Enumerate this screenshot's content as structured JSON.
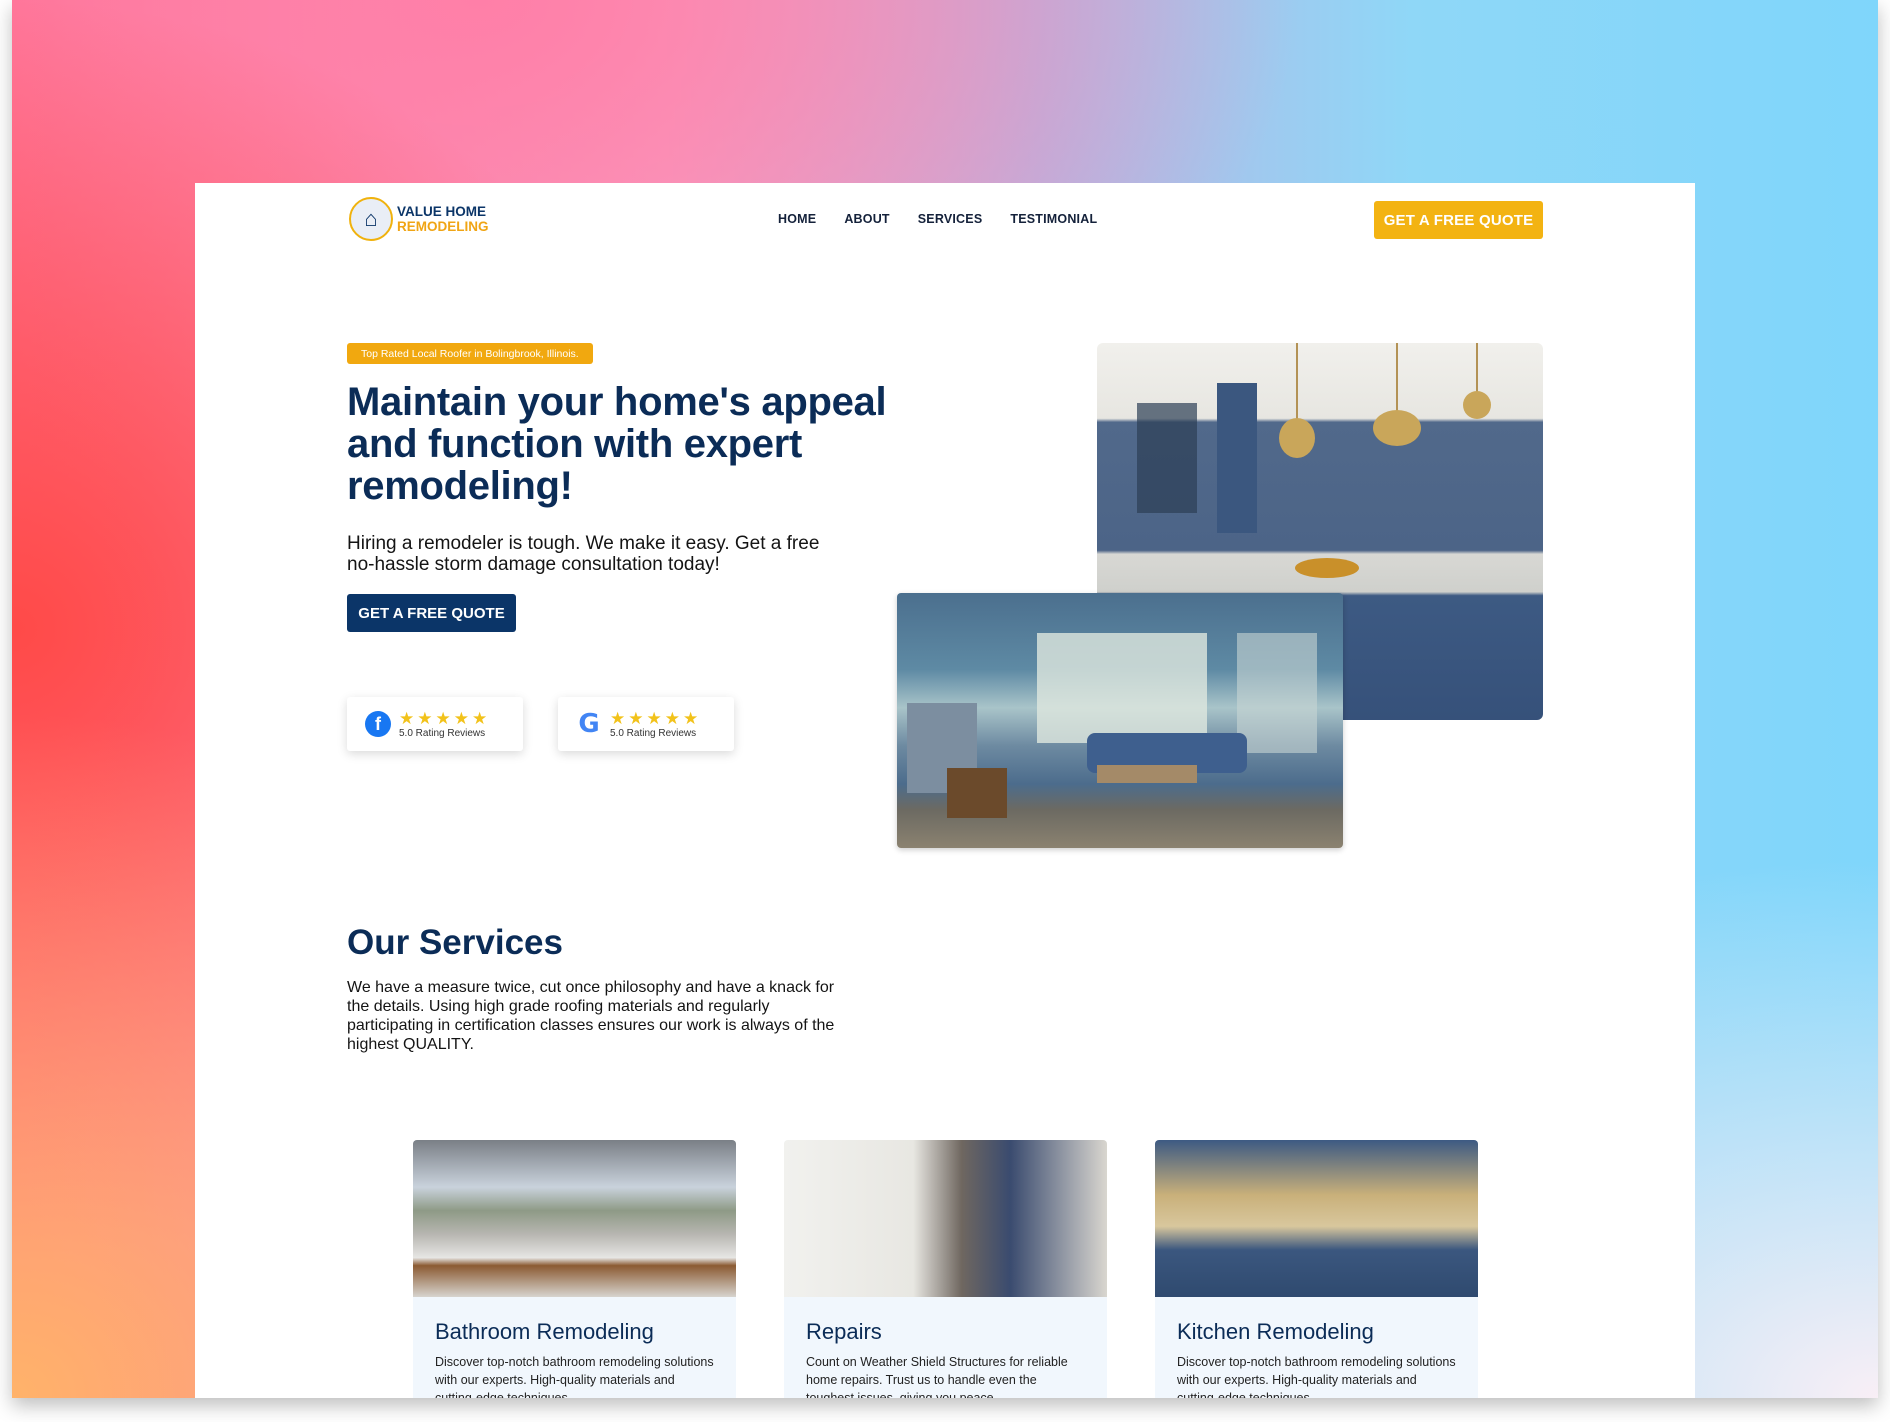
{
  "header": {
    "logo_line1": "VALUE HOME",
    "logo_line2": "REMODELING",
    "nav": [
      "HOME",
      "ABOUT",
      "SERVICES",
      "TESTIMONIAL"
    ],
    "cta": "GET A FREE QUOTE"
  },
  "hero": {
    "tag": "Top Rated Local Roofer in Bolingbrook, Illinois.",
    "title": "Maintain your home's appeal and function with expert remodeling!",
    "subtitle": "Hiring a remodeler is tough. We make it easy. Get a free no-hassle storm damage consultation today!",
    "cta": "GET A FREE QUOTE",
    "reviews": [
      {
        "icon": "facebook-icon",
        "stars": "★★★★★",
        "text": "5.0 Rating Reviews"
      },
      {
        "icon": "google-icon",
        "stars": "★★★★★",
        "text": "5.0 Rating Reviews"
      }
    ]
  },
  "services": {
    "title": "Our Services",
    "description": "We have a measure twice, cut once philosophy and have a knack for the details. Using high grade roofing materials and regularly participating in certification classes ensures our work is always of the highest QUALITY.",
    "cards": [
      {
        "title": "Bathroom Remodeling",
        "text": "Discover top-notch bathroom remodeling solutions with our experts. High-quality materials and cutting-edge techniques"
      },
      {
        "title": "Repairs",
        "text": "Count on Weather Shield Structures for reliable home repairs. Trust us to handle even the toughest issues, giving you peace"
      },
      {
        "title": "Kitchen Remodeling",
        "text": "Discover top-notch bathroom remodeling solutions with our experts. High-quality materials and cutting-edge techniques"
      }
    ]
  },
  "colors": {
    "navy": "#0b2c57",
    "accent": "#f3b312"
  }
}
